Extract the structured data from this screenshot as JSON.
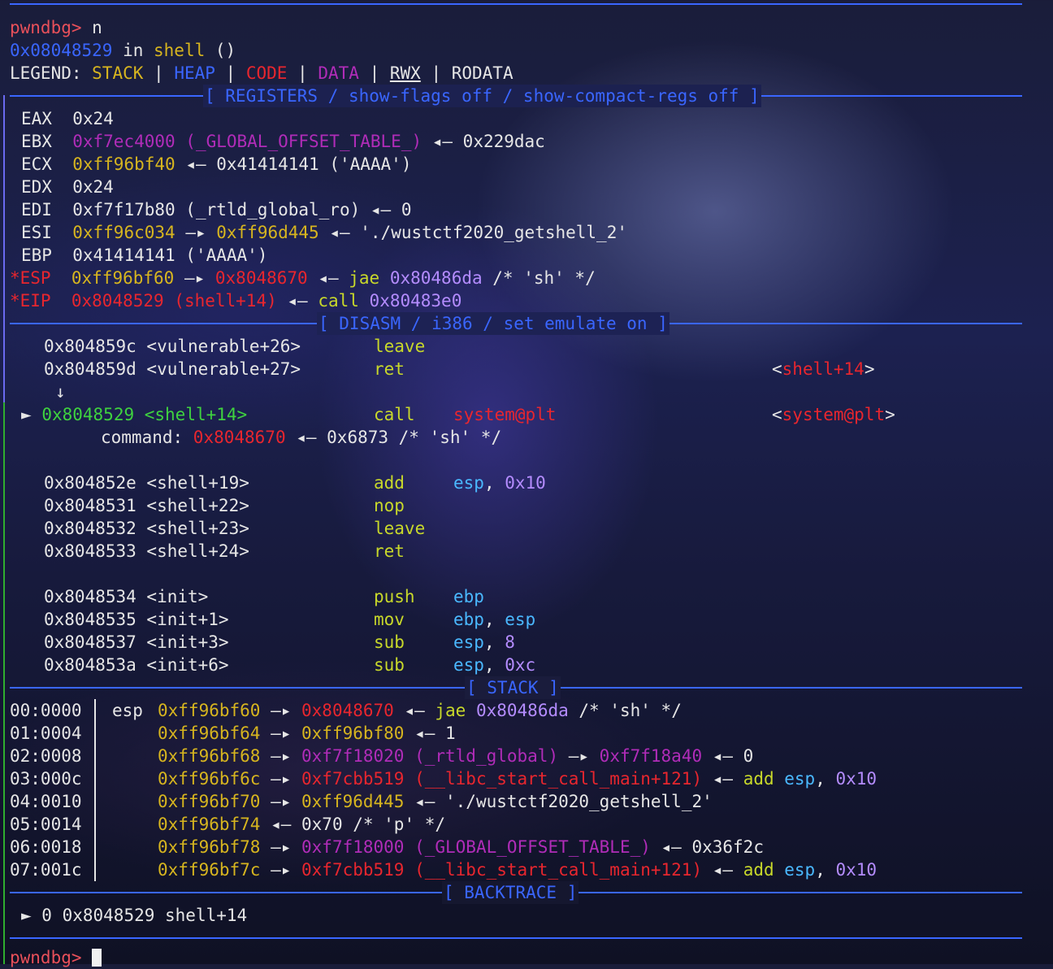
{
  "prompt": {
    "label": "pwndbg>",
    "cmd1": "n"
  },
  "location": {
    "addr": "0x08048529",
    "in_text": " in ",
    "func": "shell",
    "suffix": " ()"
  },
  "legend": {
    "title": "LEGEND: ",
    "stack": "STACK",
    "heap": "HEAP",
    "code": "CODE",
    "data": "DATA",
    "rwx": "RWX",
    "rodata": "RODATA",
    "sep": " | "
  },
  "sections": {
    "registers": "[ REGISTERS / show-flags off / show-compact-regs off ]",
    "disasm": "[ DISASM / i386 / set emulate on ]",
    "stack": "[ STACK ]",
    "backtrace": "[ BACKTRACE ]"
  },
  "registers": {
    "eax": {
      "name": "EAX",
      "val": "0x24"
    },
    "ebx": {
      "name": "EBX",
      "val": "0xf7ec4000 (_GLOBAL_OFFSET_TABLE_)",
      "rest": " ◂— 0x229dac"
    },
    "ecx": {
      "name": "ECX",
      "val": "0xff96bf40",
      "rest": " ◂— 0x41414141 ('AAAA')"
    },
    "edx": {
      "name": "EDX",
      "val": "0x24"
    },
    "edi": {
      "name": "EDI",
      "val": "0xf7f17b80 (_rtld_global_ro) ◂— 0"
    },
    "esi": {
      "name": "ESI",
      "val": "0xff96c034",
      "arrow": " —▸ ",
      "val2": "0xff96d445",
      "rest": " ◂— './wustctf2020_getshell_2'"
    },
    "ebp": {
      "name": "EBP",
      "val": "0x41414141 ('AAAA')"
    },
    "esp": {
      "name": "*ESP",
      "val": "0xff96bf60",
      "arrow": " —▸ ",
      "val2": "0x8048670",
      "mid": " ◂— ",
      "op": "jae",
      "addr": " 0x80486da",
      "cmt": " /* 'sh' */"
    },
    "eip": {
      "name": "*EIP",
      "val": "0x8048529 (shell+14)",
      "mid": " ◂— ",
      "op": "call",
      "addr": " 0x80483e0"
    }
  },
  "disasm": {
    "l1": {
      "addr": "0x804859c <vulnerable+26>",
      "op": "leave"
    },
    "l2": {
      "addr": "0x804859d <vulnerable+27>",
      "op": "ret",
      "tgt_open": "<",
      "tgt": "shell+14",
      "tgt_close": ">"
    },
    "down_arrow": "↓",
    "cur": {
      "marker": "►",
      "addr": "0x8048529 <shell+14>",
      "op": "call",
      "arg": "system@plt",
      "tgt_open": "<",
      "tgt": "system@plt",
      "tgt_close": ">"
    },
    "command": {
      "label": "command: ",
      "val": "0x8048670",
      "rest": " ◂— 0x6873 /* 'sh' */"
    },
    "l4": {
      "addr": "0x804852e <shell+19>",
      "op": "add",
      "r1": "esp",
      "c": ", ",
      "r2": "0x10"
    },
    "l5": {
      "addr": "0x8048531 <shell+22>",
      "op": "nop"
    },
    "l6": {
      "addr": "0x8048532 <shell+23>",
      "op": "leave"
    },
    "l7": {
      "addr": "0x8048533 <shell+24>",
      "op": "ret"
    },
    "l8": {
      "addr": "0x8048534 <init>",
      "op": "push",
      "r1": "ebp"
    },
    "l9": {
      "addr": "0x8048535 <init+1>",
      "op": "mov",
      "r1": "ebp",
      "c": ", ",
      "r2": "esp"
    },
    "l10": {
      "addr": "0x8048537 <init+3>",
      "op": "sub",
      "r1": "esp",
      "c": ", ",
      "r2": "8"
    },
    "l11": {
      "addr": "0x804853a <init+6>",
      "op": "sub",
      "r1": "esp",
      "c": ", ",
      "r2": "0xc"
    }
  },
  "stack": [
    {
      "off": "00:0000",
      "reg": "esp",
      "addr": "0xff96bf60",
      "a1": " —▸ ",
      "v1": "0x8048670",
      "a2": " ◂— ",
      "op": "jae",
      "v2": " 0x80486da",
      "rest": " /* 'sh' */"
    },
    {
      "off": "01:0004",
      "addr": "0xff96bf64",
      "a1": " —▸ ",
      "v1": "0xff96bf80",
      "rest": " ◂— 1"
    },
    {
      "off": "02:0008",
      "addr": "0xff96bf68",
      "a1": " —▸ ",
      "v1": "0xf7f18020 (_rtld_global)",
      "a2": " —▸ ",
      "v2": "0xf7f18a40",
      "rest": " ◂— 0"
    },
    {
      "off": "03:000c",
      "addr": "0xff96bf6c",
      "a1": " —▸ ",
      "v1": "0xf7cbb519 (__libc_start_call_main+121)",
      "a2": " ◂— ",
      "op": "add",
      "r1": " esp",
      "c": ", ",
      "r2": "0x10"
    },
    {
      "off": "04:0010",
      "addr": "0xff96bf70",
      "a1": " —▸ ",
      "v1": "0xff96d445",
      "rest": " ◂— './wustctf2020_getshell_2'"
    },
    {
      "off": "05:0014",
      "addr": "0xff96bf74",
      "rest": " ◂— 0x70 /* 'p' */"
    },
    {
      "off": "06:0018",
      "addr": "0xff96bf78",
      "a1": " —▸ ",
      "v1": "0xf7f18000 (_GLOBAL_OFFSET_TABLE_)",
      "rest": " ◂— 0x36f2c"
    },
    {
      "off": "07:001c",
      "addr": "0xff96bf7c",
      "a1": " —▸ ",
      "v1": "0xf7cbb519 (__libc_start_call_main+121)",
      "a2": " ◂— ",
      "op": "add",
      "r1": " esp",
      "c": ", ",
      "r2": "0x10"
    }
  ],
  "backtrace": {
    "marker": "►",
    "text": " 0 0x8048529 shell+14"
  },
  "prompt2": {
    "label": "pwndbg>"
  },
  "colors": {
    "prompt": "#e8505a",
    "blue": "#3a66ff",
    "yellow": "#d7b51f",
    "red": "#e8262e",
    "magenta": "#b02cb8",
    "green": "#3fd23f",
    "lime": "#c8d82a",
    "cyan": "#4ab8ff",
    "purple": "#b48cff"
  }
}
